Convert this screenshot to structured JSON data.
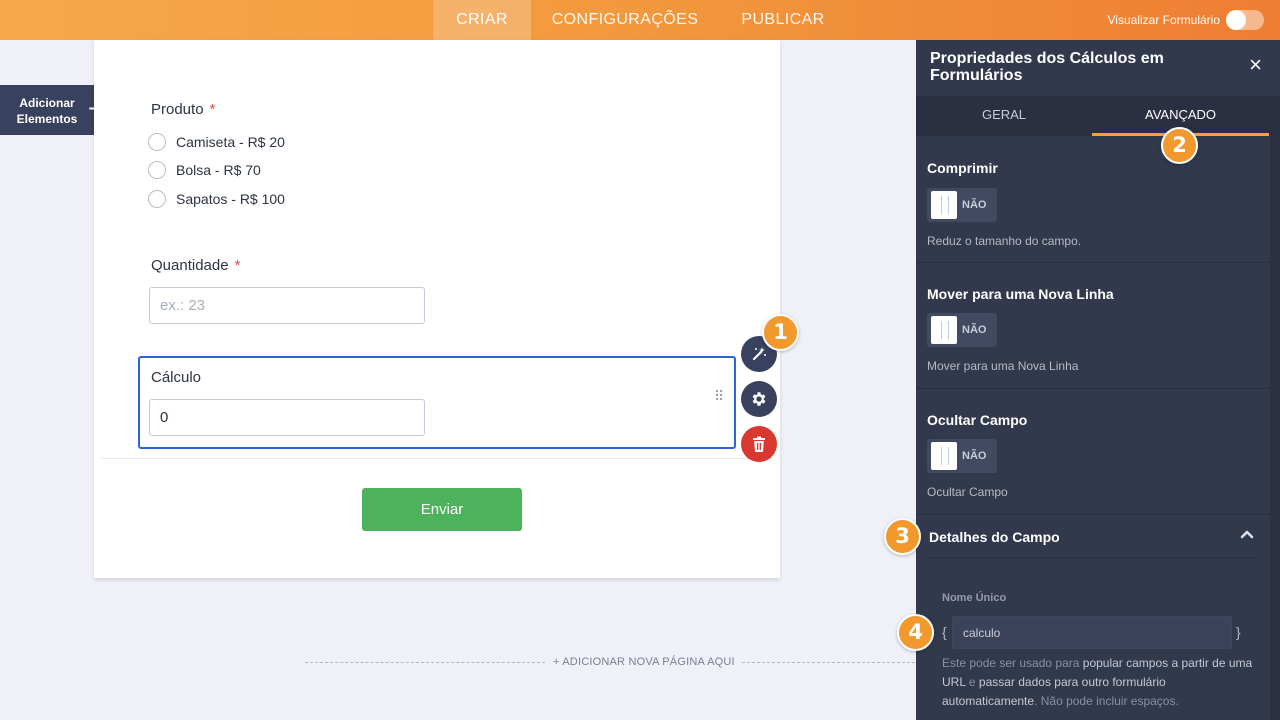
{
  "topbar": {
    "tabs": [
      "CRIAR",
      "CONFIGURAÇÕES",
      "PUBLICAR"
    ],
    "preview_label": "Visualizar Formulário"
  },
  "add_elements": {
    "line1": "Adicionar",
    "line2": "Elementos"
  },
  "form": {
    "product": {
      "label": "Produto",
      "required": "*",
      "options": [
        "Camiseta - R$ 20",
        "Bolsa - R$ 70",
        "Sapatos - R$ 100"
      ]
    },
    "quantity": {
      "label": "Quantidade",
      "required": "*",
      "placeholder": "ex.: 23"
    },
    "calculation": {
      "label": "Cálculo",
      "value": "0"
    },
    "submit_label": "Enviar"
  },
  "add_page_label": "+ ADICIONAR NOVA PÁGINA AQUI",
  "badges": [
    "1",
    "2",
    "3",
    "4"
  ],
  "panel": {
    "title": "Propriedades dos Cálculos em Formulários",
    "close_icon": "×",
    "tabs": [
      "GERAL",
      "AVANÇADO"
    ],
    "sections": [
      {
        "title": "Comprimir",
        "toggle": "NÃO",
        "desc": "Reduz o tamanho do campo."
      },
      {
        "title": "Mover para uma Nova Linha",
        "toggle": "NÃO",
        "desc": "Mover para uma Nova Linha"
      },
      {
        "title": "Ocultar Campo",
        "toggle": "NÃO",
        "desc": "Ocultar Campo"
      }
    ],
    "details": {
      "title": "Detalhes do Campo",
      "unique_name_label": "Nome Único",
      "unique_name_value": "calculo",
      "brace_open": "{",
      "brace_close": "}",
      "help": {
        "p1": "Este pode ser usado para ",
        "l1": "popular campos a partir de uma URL",
        "p2": " e ",
        "l2": "passar dados para outro formulário automaticamente",
        "p3": ". Não pode incluir espaços."
      }
    }
  },
  "colors": {
    "accent": "#f39a3e",
    "panel_bg": "#33394d",
    "submit": "#4cb25b",
    "delete": "#d9382f",
    "selected_border": "#2b65d9"
  }
}
